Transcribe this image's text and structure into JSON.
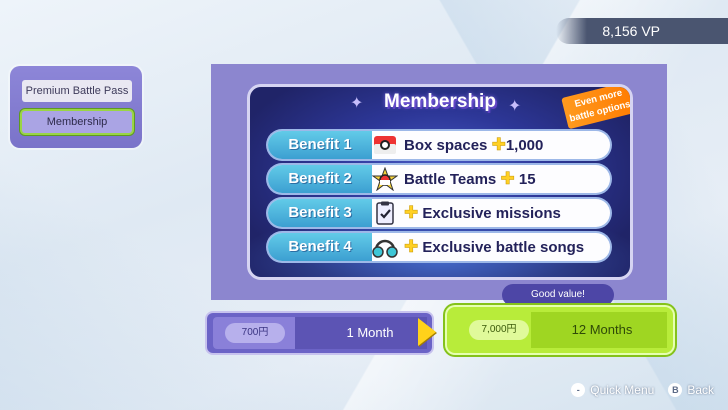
{
  "vp": "8,156 VP",
  "sidebar": {
    "items": [
      {
        "label": "Premium Battle Pass"
      },
      {
        "label": "Membership"
      }
    ]
  },
  "panel": {
    "title": "Membership",
    "ribbon": "Even more\nbattle options!",
    "benefits": [
      {
        "label": "Benefit 1",
        "icon": "poke-ball-box-icon",
        "text": "Box spaces",
        "value": "1,000"
      },
      {
        "label": "Benefit 2",
        "icon": "poke-ball-star-icon",
        "text": "Battle Teams",
        "value": "15"
      },
      {
        "label": "Benefit 3",
        "icon": "clipboard-check-icon",
        "text": "Exclusive missions",
        "value": ""
      },
      {
        "label": "Benefit 4",
        "icon": "headphones-icon",
        "text": "Exclusive battle songs",
        "value": ""
      }
    ]
  },
  "plans": [
    {
      "price": "700円",
      "label": "1 Month"
    },
    {
      "price": "7,000円",
      "label": "12 Months"
    }
  ],
  "tooltip": "Good value!",
  "footer": {
    "quick_menu": "Quick Menu",
    "quick_menu_key": "-",
    "back": "Back",
    "back_key": "B"
  },
  "colors": {
    "accent_green": "#b8ec3a",
    "panel_purple": "#8c86cf",
    "benefit_blue": "#3c9fd1",
    "plus_yellow": "#ffd024"
  }
}
